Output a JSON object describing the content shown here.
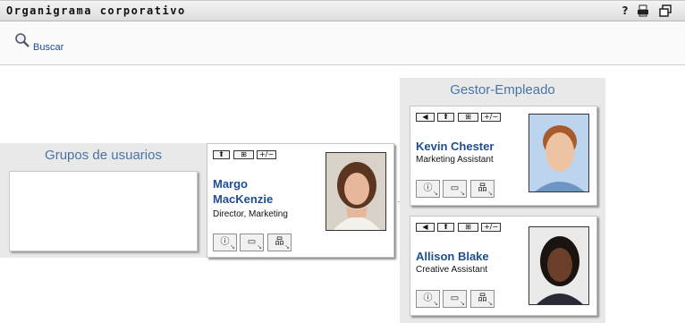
{
  "header": {
    "title": "Organigrama corporativo"
  },
  "toolbar": {
    "search_label": "Buscar"
  },
  "groups_panel": {
    "title": "Grupos de usuarios"
  },
  "manager_panel": {
    "title": "Gestor-Empleado"
  },
  "manager_card": {
    "name_line1": "Margo",
    "name_line2": "MacKenzie",
    "role": "Director, Marketing"
  },
  "employees": [
    {
      "name": "Kevin Chester",
      "role": "Marketing Assistant"
    },
    {
      "name": "Allison Blake",
      "role": "Creative Assistant"
    }
  ],
  "icons": {
    "help": "?",
    "print": "⎙",
    "restore": "❐",
    "info": "ⓘ",
    "card": "▭",
    "org": "品",
    "up": "⬆",
    "plusminus": "+/−",
    "left": "◀",
    "expand": "⊞"
  },
  "colors": {
    "accent": "#1f4d94",
    "panel_title": "#4a74a6"
  }
}
